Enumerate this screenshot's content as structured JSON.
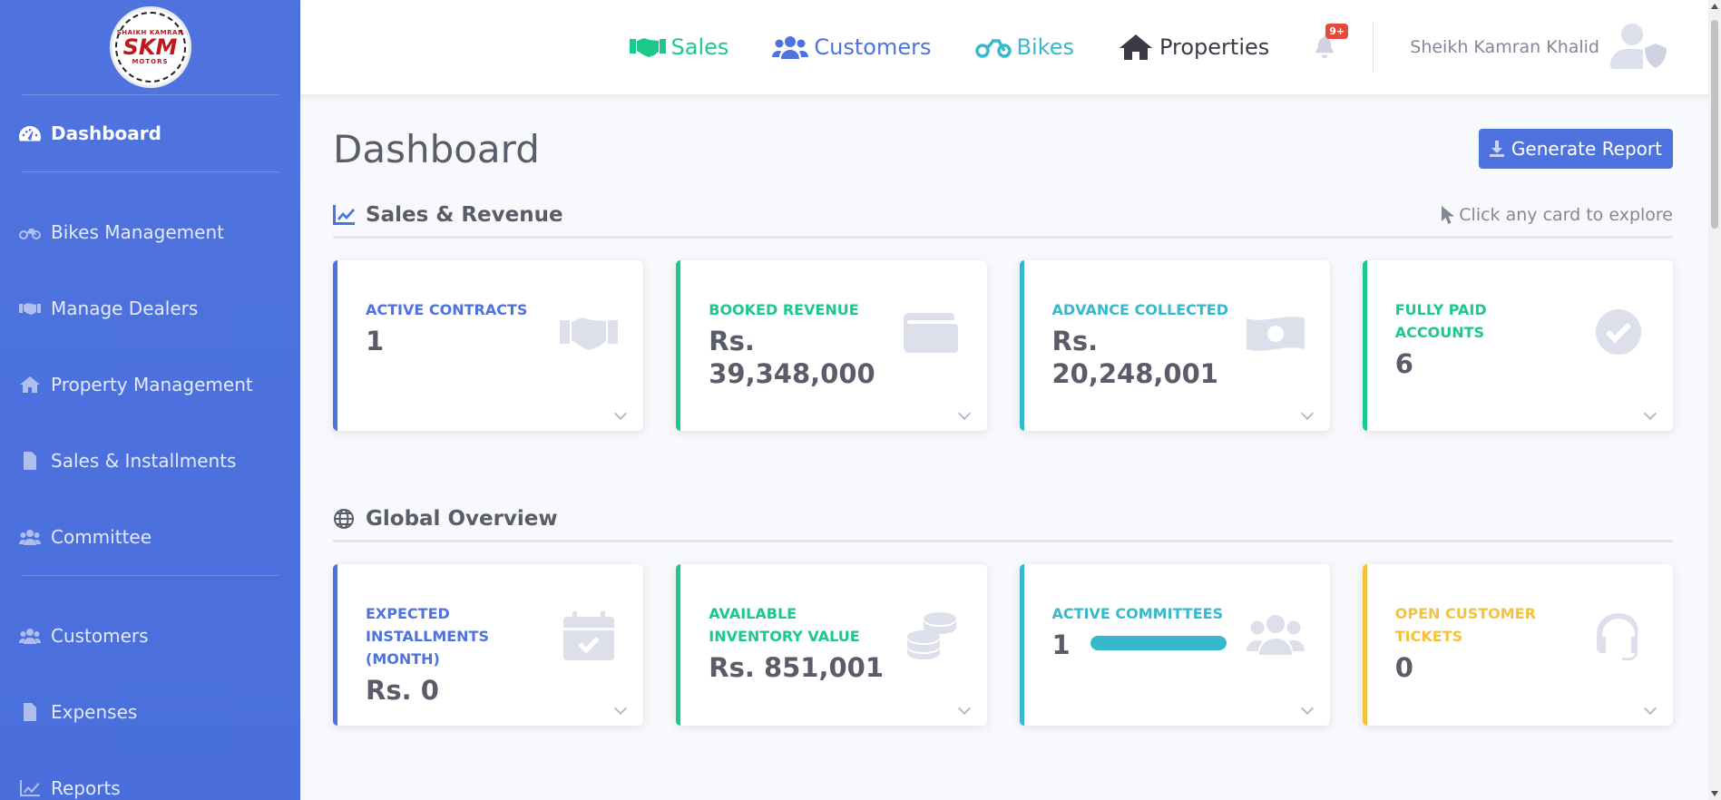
{
  "brand": {
    "logo_top": "SHAIKH KAMRAN",
    "logo_main": "SKM",
    "logo_bottom": "MOTORS"
  },
  "sidebar": {
    "items": [
      {
        "label": "Dashboard",
        "icon": "tachometer-icon",
        "active": true
      },
      {
        "label": "Bikes Management",
        "icon": "motorcycle-icon"
      },
      {
        "label": "Manage Dealers",
        "icon": "handshake-icon"
      },
      {
        "label": "Property Management",
        "icon": "home-icon"
      },
      {
        "label": "Sales & Installments",
        "icon": "file-invoice-icon"
      },
      {
        "label": "Committee",
        "icon": "users-icon"
      },
      {
        "label": "Customers",
        "icon": "users-icon"
      },
      {
        "label": "Expenses",
        "icon": "file-invoice-icon"
      },
      {
        "label": "Reports",
        "icon": "chart-line-icon"
      }
    ]
  },
  "topbar": {
    "links": {
      "sales": "Sales",
      "customers": "Customers",
      "bikes": "Bikes",
      "properties": "Properties"
    },
    "notification_count": "9+",
    "user_name": "Sheikh Kamran Khalid"
  },
  "page": {
    "title": "Dashboard",
    "generate_report": "Generate Report"
  },
  "sections": {
    "sales": {
      "title": "Sales & Revenue",
      "hint": "Click any card to explore",
      "cards": [
        {
          "label": "Active Contracts",
          "value": "1",
          "color": "#4e73df",
          "icon": "handshake-icon"
        },
        {
          "label": "Booked Revenue",
          "value": "Rs. 39,348,000",
          "color": "#1cc88a",
          "icon": "wallet-icon"
        },
        {
          "label": "Advance Collected",
          "value": "Rs. 20,248,001",
          "color": "#36b9cc",
          "icon": "money-bill-icon"
        },
        {
          "label": "Fully Paid Accounts",
          "value": "6",
          "color": "#1cc88a",
          "icon": "check-circle-icon"
        }
      ]
    },
    "global": {
      "title": "Global Overview",
      "cards": [
        {
          "label": "Expected Installments (Month)",
          "value": "Rs. 0",
          "color": "#4e73df",
          "icon": "calendar-check-icon"
        },
        {
          "label": "Available Inventory Value",
          "value": "Rs. 851,001",
          "color": "#1cc88a",
          "icon": "coins-icon"
        },
        {
          "label": "Active Committees",
          "value": "1",
          "color": "#36b9cc",
          "icon": "users-icon",
          "progress": 1.0
        },
        {
          "label": "Open Customer Tickets",
          "value": "0",
          "color": "#f6c23e",
          "icon": "headset-icon"
        }
      ]
    }
  }
}
